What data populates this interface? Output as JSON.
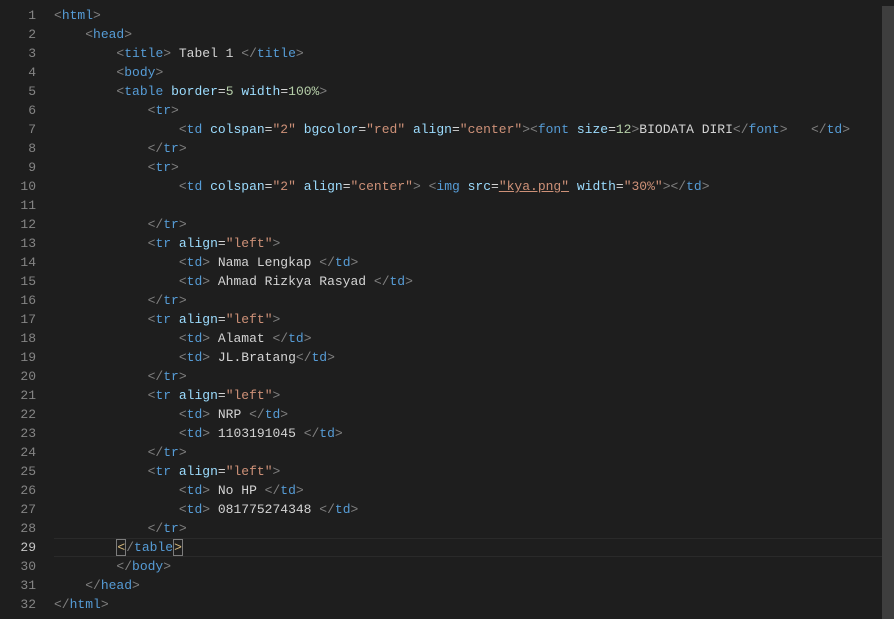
{
  "lineNumbers": [
    "1",
    "2",
    "3",
    "4",
    "5",
    "6",
    "7",
    "8",
    "9",
    "10",
    "11",
    "12",
    "13",
    "14",
    "15",
    "16",
    "17",
    "18",
    "19",
    "20",
    "21",
    "22",
    "23",
    "24",
    "25",
    "26",
    "27",
    "28",
    "29",
    "30",
    "31",
    "32"
  ],
  "currentLine": "29",
  "code": {
    "title_text": " Tabel 1 ",
    "border_val": "5",
    "width_val": "100%",
    "colspan": "\"2\"",
    "bgcolor": "\"red\"",
    "align_center": "\"center\"",
    "align_left": "\"left\"",
    "font_size": "12",
    "biodata": "BIODATA DIRI",
    "img_src": "\"kya.png\"",
    "img_width": "\"30%\"",
    "nama_label": " Nama Lengkap ",
    "nama_val": " Ahmad Rizkya Rasyad ",
    "alamat_label": " Alamat ",
    "alamat_val": " JL.Bratang",
    "nrp_label": " NRP ",
    "nrp_val": " 1103191045 ",
    "hp_label": " No HP ",
    "hp_val": " 081775274348 "
  }
}
